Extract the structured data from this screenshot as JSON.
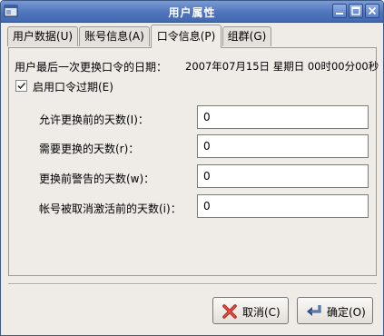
{
  "window": {
    "title": "用户属性",
    "icon": "window-app-icon",
    "controls": [
      "minimize-icon",
      "maximize-icon",
      "close-icon"
    ]
  },
  "tabs": [
    {
      "label": "用户数据(U)"
    },
    {
      "label": "账号信息(A)"
    },
    {
      "label": "口令信息(P)",
      "active": true
    },
    {
      "label": "组群(G)"
    }
  ],
  "panel": {
    "last_change_label": "用户最后一次更换口令的日期：",
    "last_change_value": "2007年07月15日 星期日 00时00分00秒",
    "expire_checkbox": {
      "label": "启用口令过期(E)",
      "checked": true
    },
    "fields": [
      {
        "label": "允许更换前的天数(I)：",
        "value": "0"
      },
      {
        "label": "需要更换的天数(r)：",
        "value": "0"
      },
      {
        "label": "更换前警告的天数(w)：",
        "value": "0"
      },
      {
        "label": "帐号被取消激活前的天数(i)：",
        "value": "0"
      }
    ]
  },
  "buttons": {
    "cancel": {
      "label": "取消(C)",
      "icon": "cancel-x-icon"
    },
    "ok": {
      "label": "确定(O)",
      "icon": "enter-arrow-icon"
    }
  }
}
